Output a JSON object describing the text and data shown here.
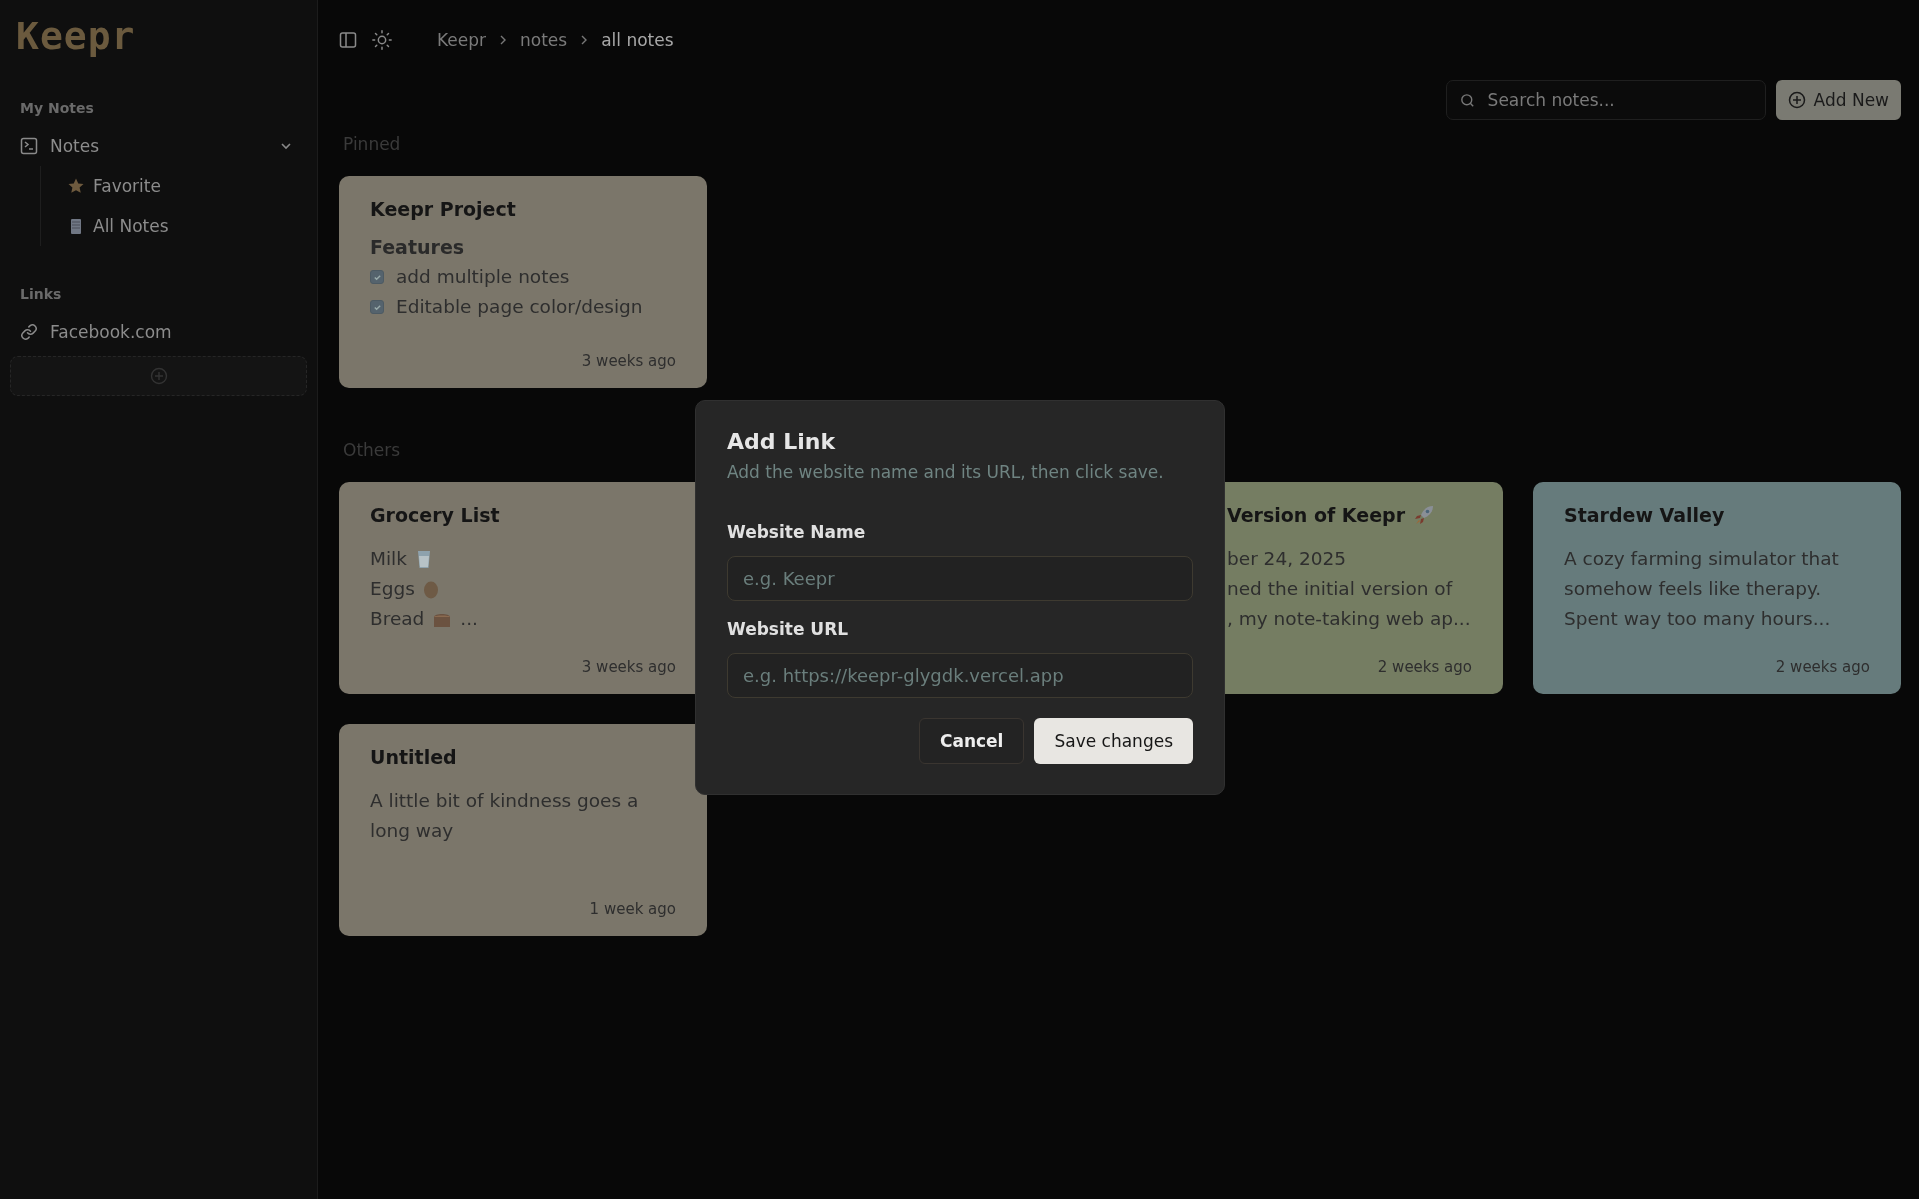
{
  "sidebar": {
    "logo": "Keepr",
    "sections": [
      {
        "title": "My Notes",
        "items": [
          {
            "label": "Notes",
            "expanded": true,
            "children": [
              {
                "label": "Favorite"
              },
              {
                "label": "All Notes"
              }
            ]
          }
        ]
      },
      {
        "title": "Links",
        "items": [
          {
            "label": "Facebook.com"
          }
        ]
      }
    ]
  },
  "breadcrumb": [
    "Keepr",
    "notes",
    "all notes"
  ],
  "search": {
    "placeholder": "Search notes..."
  },
  "add_button": "Add New",
  "groups": [
    {
      "title": "Pinned",
      "notes": [
        {
          "title": "Keepr Project",
          "kind": "checklist",
          "heading": "Features",
          "items": [
            {
              "text": "add multiple notes",
              "checked": true
            },
            {
              "text": "Editable page color/design",
              "checked": true
            }
          ],
          "time": "3 weeks ago",
          "color": "#7b766a"
        }
      ]
    },
    {
      "title": "Others",
      "notes": [
        {
          "title": "Grocery List",
          "kind": "lines",
          "lines": [
            {
              "text": "Milk"
            },
            {
              "text": "Eggs"
            },
            {
              "text": "Bread",
              "suffix": "..."
            }
          ],
          "time": "3 weeks ago",
          "color": "#7b766a"
        },
        {
          "title": "Version of Keepr",
          "title_icon": true,
          "kind": "text",
          "lines": [
            "ber 24, 2025",
            "ned the initial version of",
            ", my note-taking web ap..."
          ],
          "time": "2 weeks ago",
          "color": "#757d62"
        },
        {
          "title": "Stardew Valley",
          "kind": "paragraph",
          "text": "A cozy farming simulator that somehow feels like therapy. Spent way too many hours...",
          "time": "2 weeks ago",
          "color": "#667b7c"
        },
        {
          "title": "Untitled",
          "kind": "paragraph",
          "text": "A little bit of kindness goes a long way",
          "time": "1 week ago",
          "color": "#7b766a"
        }
      ]
    }
  ],
  "dialog": {
    "title": "Add Link",
    "description": "Add the website name and its URL, then click save.",
    "fields": [
      {
        "label": "Website Name",
        "placeholder": "e.g. Keepr"
      },
      {
        "label": "Website URL",
        "placeholder": "e.g. https://keepr-glygdk.vercel.app"
      }
    ],
    "buttons": [
      {
        "label": "Cancel",
        "kind": "secondary"
      },
      {
        "label": "Save changes",
        "kind": "primary"
      }
    ]
  }
}
